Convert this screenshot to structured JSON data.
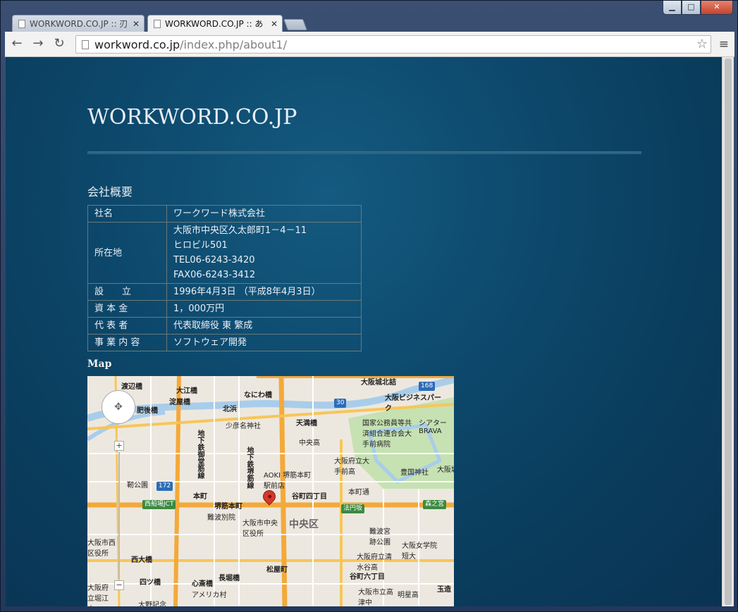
{
  "browser": {
    "tabs": [
      {
        "label": "WORKWORD.CO.JP :: 刃"
      },
      {
        "label": "WORKWORD.CO.JP :: あ"
      }
    ],
    "address": {
      "host": "workword.co.jp",
      "path": "/index.php/about1/"
    }
  },
  "page": {
    "site_title": "WORKWORD.CO.JP",
    "section_title": "会社概要",
    "company_info": [
      {
        "key": "社名",
        "value": "ワークワード株式会社"
      },
      {
        "key": "所在地",
        "value_lines": [
          "大阪市中央区久太郎町1－4－11",
          "ヒロビル501",
          "TEL06-6243-3420",
          "FAX06-6243-3412"
        ]
      },
      {
        "key": "設　　立",
        "value": "1996年4月3日 （平成8年4月3日）"
      },
      {
        "key": "資 本 金",
        "value": "1，000万円"
      },
      {
        "key": "代 表 者",
        "value": "代表取締役 東 繁成"
      },
      {
        "key": "事 業 内 容",
        "value": "ソフトウェア開発"
      }
    ],
    "map_label": "Map"
  },
  "map": {
    "labels": [
      "渡辺橋",
      "大江橋",
      "なにわ橋",
      "大阪城北詰",
      "大阪ビジネスパーク",
      "淀屋橋",
      "北浜",
      "天満橋",
      "肥後橋",
      "少彦名神社",
      "国家公務員等共済組合連合会大手前病院",
      "シアターBRAVA",
      "中央高",
      "大阪府立大手前高",
      "AOKI 堺筋本町駅前店",
      "豊国神社",
      "大阪城",
      "靭公園",
      "本町",
      "堺筋本町",
      "谷町四丁目",
      "本町通",
      "西船場JCT",
      "法円坂",
      "森之宮",
      "難波別院",
      "大阪市中央区役所",
      "中央区",
      "難波宮跡公園",
      "大阪女学院短大",
      "大阪府立清水谷高",
      "西大橋",
      "長堀橋",
      "松屋町",
      "谷町六丁目",
      "四ツ橋",
      "心斎橋",
      "アメリカ村",
      "大阪市立高津中",
      "明星高",
      "玉造",
      "大阪市西区役所",
      "大阪府立堀江小",
      "大野記念",
      "168",
      "30",
      "172",
      "地下鉄御堂筋線",
      "地下鉄堺筋線"
    ]
  }
}
